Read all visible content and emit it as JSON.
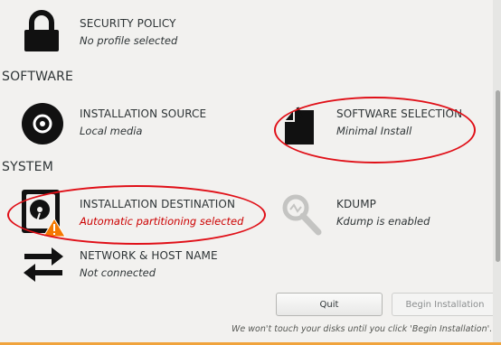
{
  "spokes": {
    "security_policy": {
      "title": "SECURITY POLICY",
      "status": "No profile selected",
      "icon": "lock-icon"
    },
    "installation_source": {
      "title": "INSTALLATION SOURCE",
      "status": "Local media",
      "icon": "disc-icon"
    },
    "software_selection": {
      "title": "SOFTWARE SELECTION",
      "status": "Minimal Install",
      "icon": "package-icon"
    },
    "installation_destination": {
      "title": "INSTALLATION DESTINATION",
      "status": "Automatic partitioning selected",
      "icon": "harddisk-warning-icon"
    },
    "kdump": {
      "title": "KDUMP",
      "status": "Kdump is enabled",
      "icon": "magnifier-icon"
    },
    "network": {
      "title": "NETWORK & HOST NAME",
      "status": "Not connected",
      "icon": "network-arrows-icon"
    }
  },
  "sections": {
    "software": "SOFTWARE",
    "system": "SYSTEM"
  },
  "buttons": {
    "quit": "Quit",
    "begin": "Begin Installation"
  },
  "footer_note": "We won't touch your disks until you click 'Begin Installation'.",
  "colors": {
    "warning": "#cc0000",
    "highlight_ellipse": "#e01018",
    "accent_bar": "#f0a33c"
  }
}
